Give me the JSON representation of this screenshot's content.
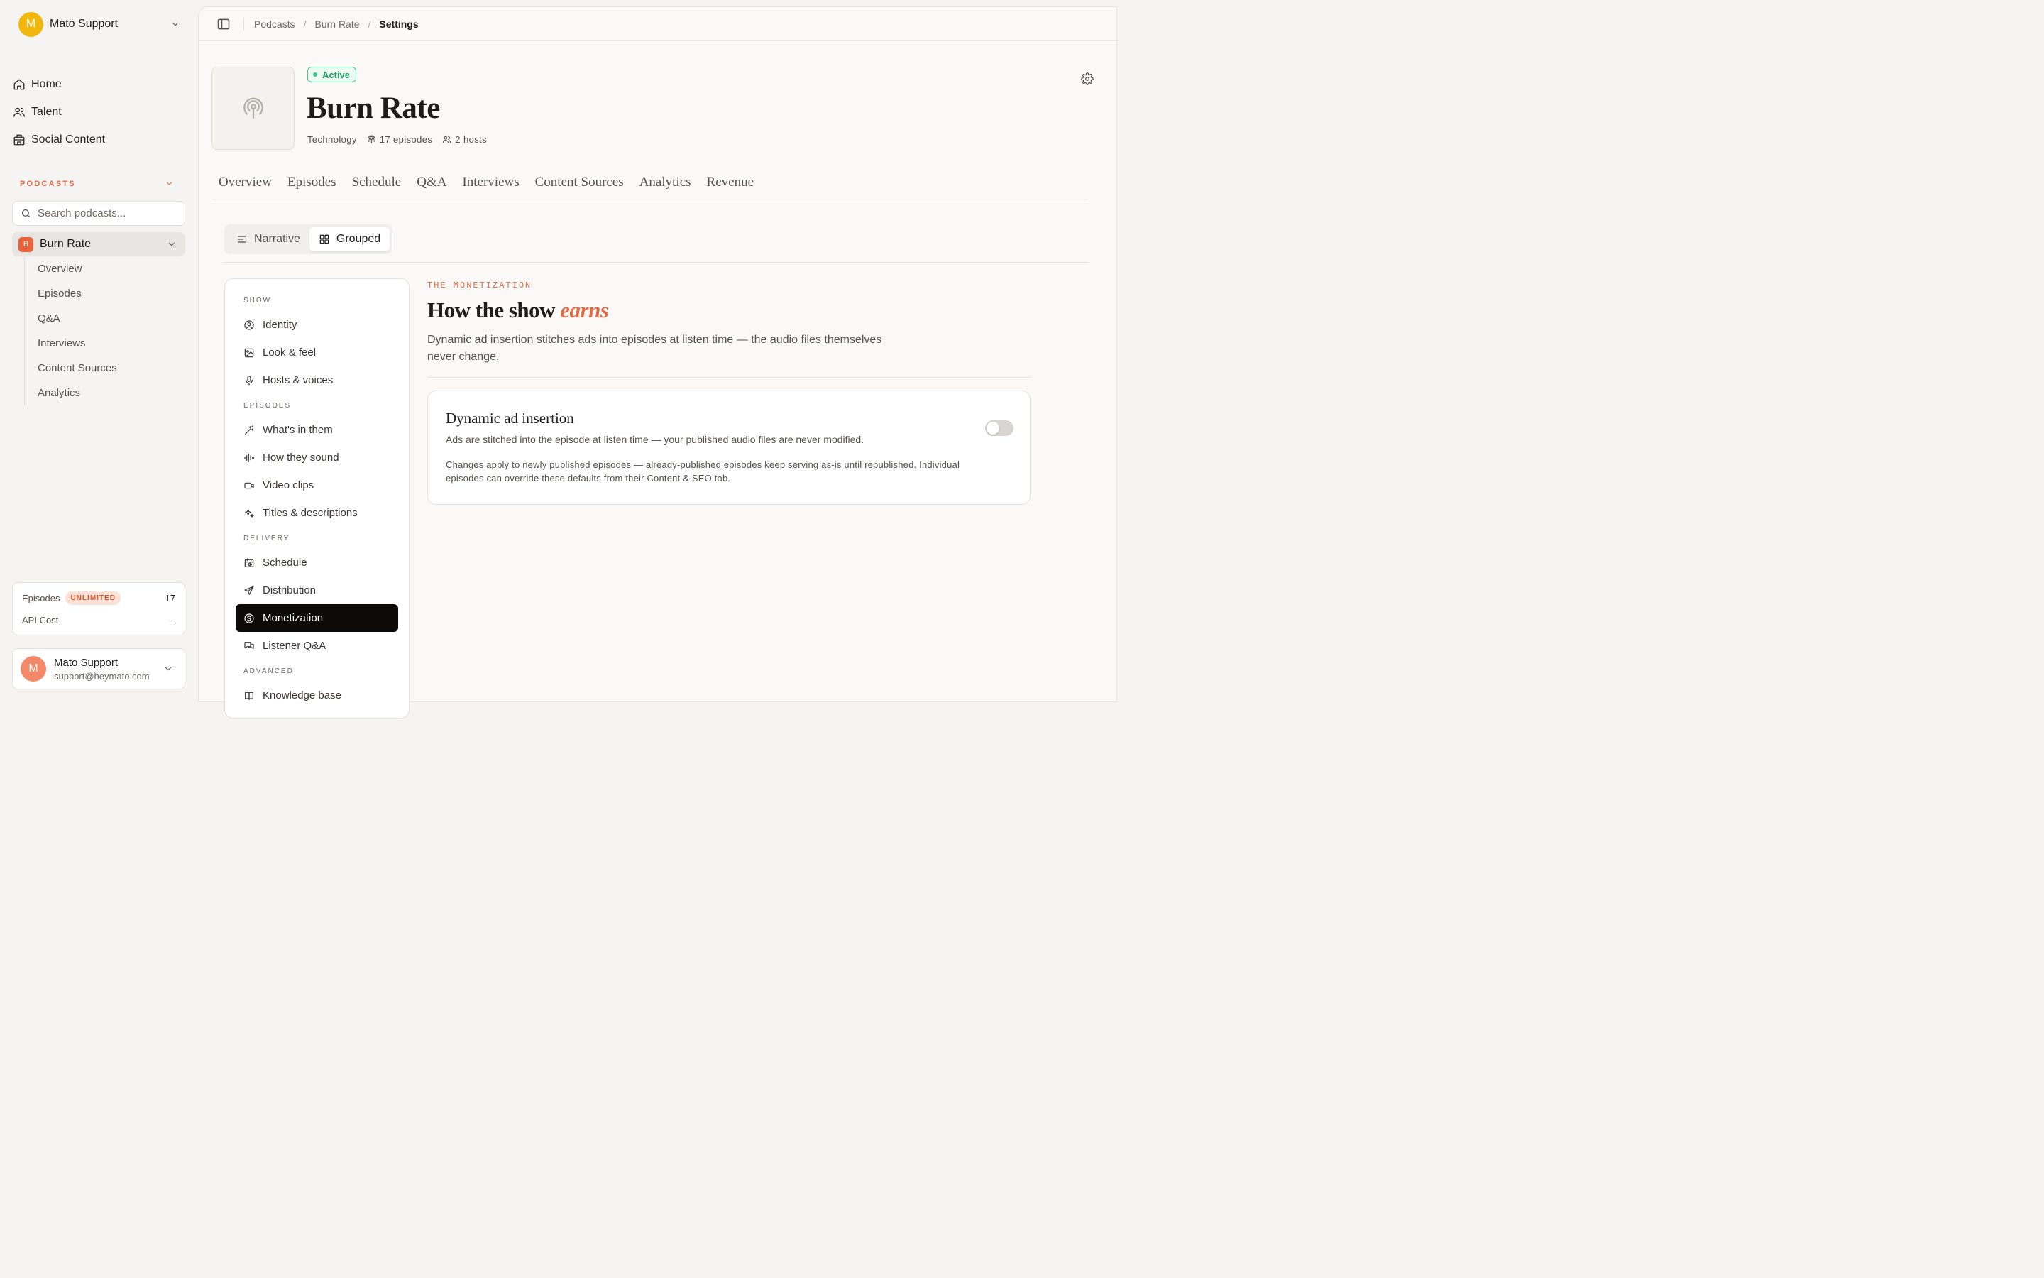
{
  "org": {
    "initial": "M",
    "name": "Mato Support"
  },
  "nav": [
    {
      "label": "Home",
      "icon": "home-icon"
    },
    {
      "label": "Talent",
      "icon": "users-icon"
    },
    {
      "label": "Social Content",
      "icon": "building-icon"
    }
  ],
  "podcasts_section": {
    "label": "PODCASTS",
    "search_placeholder": "Search podcasts..."
  },
  "active_podcast": {
    "initial": "B",
    "name": "Burn Rate",
    "subnav": [
      "Overview",
      "Episodes",
      "Q&A",
      "Interviews",
      "Content Sources",
      "Analytics"
    ]
  },
  "usage": {
    "episodes_label": "Episodes",
    "episodes_badge": "UNLIMITED",
    "episodes_value": "17",
    "api_label": "API Cost",
    "api_value": "–"
  },
  "user": {
    "initial": "M",
    "name": "Mato Support",
    "email": "support@heymato.com"
  },
  "breadcrumb": {
    "items": [
      "Podcasts",
      "Burn Rate"
    ],
    "current": "Settings",
    "separator": "/"
  },
  "header": {
    "status": "Active",
    "title": "Burn Rate",
    "category": "Technology",
    "episodes": "17 episodes",
    "hosts": "2 hosts"
  },
  "tabs": [
    "Overview",
    "Episodes",
    "Schedule",
    "Q&A",
    "Interviews",
    "Content Sources",
    "Analytics",
    "Revenue"
  ],
  "view_toggle": {
    "narrative": "Narrative",
    "grouped": "Grouped",
    "selected": "Grouped"
  },
  "settings_nav": {
    "show_head": "SHOW",
    "show": [
      {
        "label": "Identity",
        "icon": "user-circle-icon"
      },
      {
        "label": "Look & feel",
        "icon": "image-icon"
      },
      {
        "label": "Hosts & voices",
        "icon": "microphone-icon"
      }
    ],
    "episodes_head": "EPISODES",
    "episodes": [
      {
        "label": "What's in them",
        "icon": "magic-wand-icon"
      },
      {
        "label": "How they sound",
        "icon": "waveform-icon"
      },
      {
        "label": "Video clips",
        "icon": "video-icon"
      },
      {
        "label": "Titles & descriptions",
        "icon": "sparkles-icon"
      }
    ],
    "delivery_head": "DELIVERY",
    "delivery": [
      {
        "label": "Schedule",
        "icon": "calendar-clock-icon"
      },
      {
        "label": "Distribution",
        "icon": "send-icon"
      },
      {
        "label": "Monetization",
        "icon": "dollar-circle-icon",
        "active": true
      },
      {
        "label": "Listener Q&A",
        "icon": "chat-bubbles-icon"
      }
    ],
    "advanced_head": "ADVANCED",
    "advanced": [
      {
        "label": "Knowledge base",
        "icon": "book-icon"
      }
    ]
  },
  "content": {
    "eyebrow": "THE MONETIZATION",
    "heading_plain": "How the show",
    "heading_accent": "earns",
    "lede": "Dynamic ad insertion stitches ads into episodes at listen time — the audio files themselves never change.",
    "card": {
      "title": "Dynamic ad insertion",
      "description": "Ads are stitched into the episode at listen time — your published audio files are never modified.",
      "note": "Changes apply to newly published episodes — already-published episodes keep serving as-is until republished. Individual episodes can override these defaults from their Content & SEO tab.",
      "enabled": false
    }
  },
  "colors": {
    "accent": "#e36a43",
    "active_green": "#3fc887",
    "org_avatar": "#f2b70f",
    "user_avatar": "#f4896a"
  }
}
